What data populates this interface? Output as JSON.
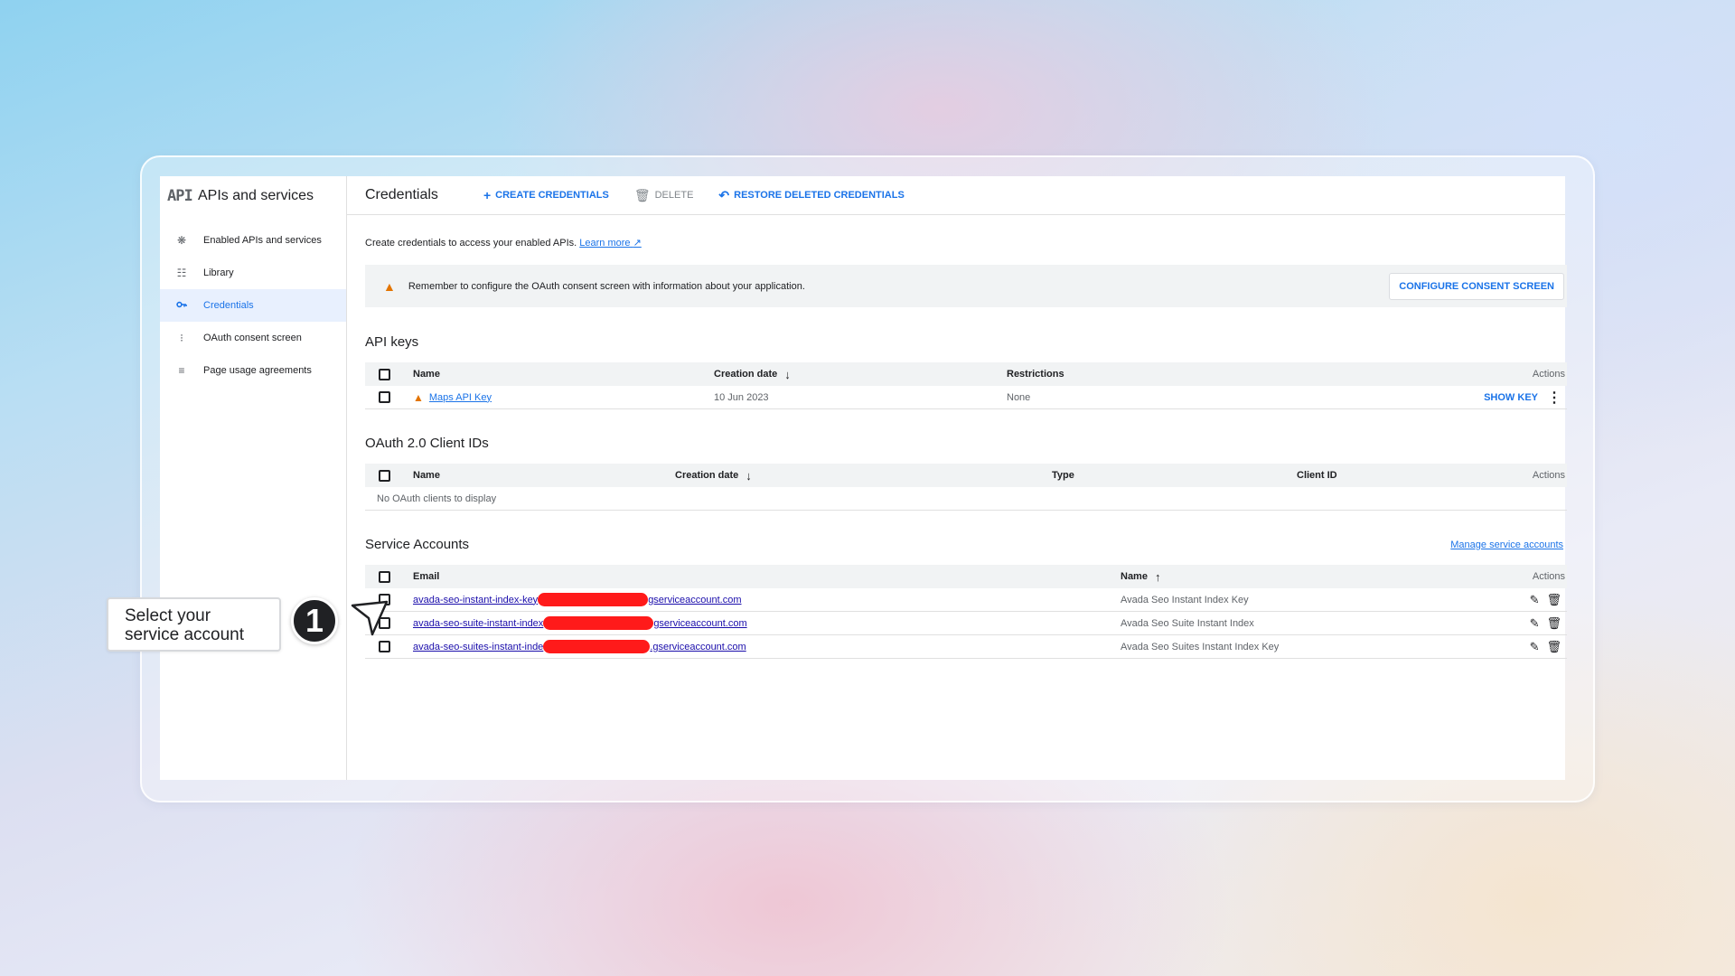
{
  "sidebar": {
    "logo": "API",
    "title": "APIs and services",
    "items": [
      {
        "label": "Enabled APIs and services",
        "icon": "hub-icon"
      },
      {
        "label": "Library",
        "icon": "library-icon"
      },
      {
        "label": "Credentials",
        "icon": "key-icon",
        "active": true
      },
      {
        "label": "OAuth consent screen",
        "icon": "consent-icon"
      },
      {
        "label": "Page usage agreements",
        "icon": "settings-list-icon"
      }
    ]
  },
  "toolbar": {
    "title": "Credentials",
    "create_label": "CREATE CREDENTIALS",
    "delete_label": "DELETE",
    "restore_label": "RESTORE DELETED CREDENTIALS"
  },
  "intro": {
    "text": "Create credentials to access your enabled APIs.",
    "learn_more": "Learn more"
  },
  "banner": {
    "text": "Remember to configure the OAuth consent screen with information about your application.",
    "button": "CONFIGURE CONSENT SCREEN"
  },
  "api_keys": {
    "title": "API keys",
    "headers": {
      "name": "Name",
      "created": "Creation date",
      "restrictions": "Restrictions",
      "actions": "Actions"
    },
    "rows": [
      {
        "name": "Maps API Key",
        "created": "10 Jun 2023",
        "restrictions": "None",
        "action": "SHOW KEY"
      }
    ]
  },
  "oauth": {
    "title": "OAuth 2.0 Client IDs",
    "headers": {
      "name": "Name",
      "created": "Creation date",
      "type": "Type",
      "client_id": "Client ID",
      "actions": "Actions"
    },
    "empty": "No OAuth clients to display"
  },
  "service_accounts": {
    "title": "Service Accounts",
    "manage_link": "Manage service accounts",
    "headers": {
      "email": "Email",
      "name": "Name",
      "actions": "Actions"
    },
    "rows": [
      {
        "email_prefix": "avada-seo-instant-index-key",
        "email_suffix": "gserviceaccount.com",
        "name": "Avada Seo Instant Index Key"
      },
      {
        "email_prefix": "avada-seo-suite-instant-index",
        "email_suffix": "gserviceaccount.com",
        "name": "Avada Seo Suite Instant Index"
      },
      {
        "email_prefix": "avada-seo-suites-instant-inde",
        "email_suffix": ".gserviceaccount.com",
        "name": "Avada Seo Suites Instant Index Key"
      }
    ]
  },
  "callout": {
    "text": "Select your service account",
    "step": "1"
  },
  "colors": {
    "accent": "#1a73e8",
    "warning": "#e37400",
    "redaction": "#ff1a1a"
  }
}
